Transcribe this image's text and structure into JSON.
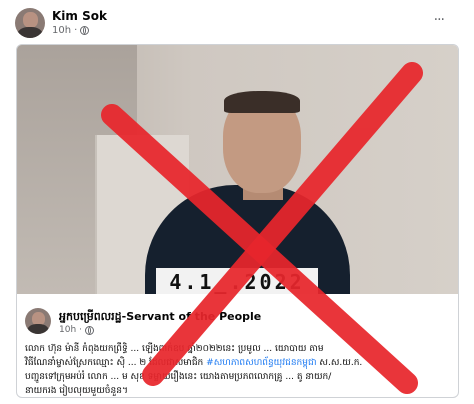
{
  "post": {
    "author": "Kim Sok",
    "time": "10h",
    "more_label": "···"
  },
  "shared_post": {
    "author": "អ្នកបម្រើពលរដ្ឋ-Servant of the People",
    "time": "10h",
    "date_overlay": "4.1_.2022",
    "caption_lines": [
      "លោក ហ៊ុន ម៉ានី កំពុងយកព្រឹទ្ធិ ... ឡើងពាក់ឧប ឆ្នាំ២០២២នេះ ប្រមូល ... យោបាយ តាម",
      "វិធីណែនាំម្ចាស់ស្រែកឈ្មោះ ស៊ិ ... ២ ដែលជាសមាជិក",
      "បញ្ជូនទៅក្រុមអប់រំ លោក ... ម សុខ ទម្លាយរឿងនេះ យោងតាមប្រភពលោកគ្រូ ... តូ នាយក/",
      "នាយករង រៀបលុយមួយចំនួន។"
    ],
    "hashtag": "#សហភាពសហព័ន្ធយុវជនកម្ពុជា",
    "caption_tail": "ស.ស.យ.ក."
  },
  "colors": {
    "cross": "#e8262c",
    "hashtag": "#1877f2",
    "text_secondary": "#65676b"
  }
}
